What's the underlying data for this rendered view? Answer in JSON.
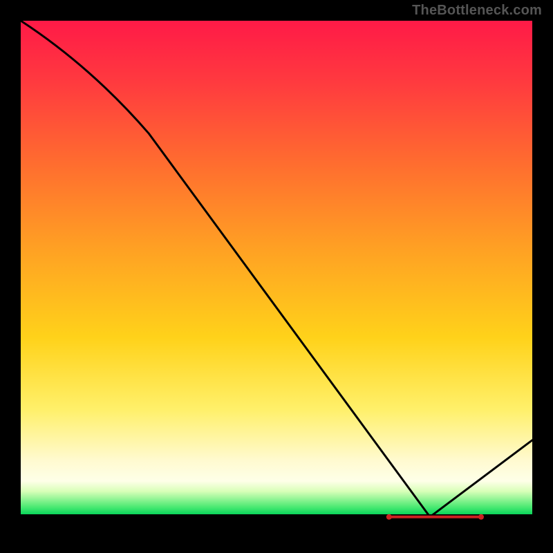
{
  "watermark": "TheBottleneck.com",
  "chart_data": {
    "type": "line",
    "title": "",
    "xlabel": "",
    "ylabel": "",
    "xlim": [
      0,
      100
    ],
    "ylim": [
      0,
      100
    ],
    "x": [
      0,
      25,
      80,
      100
    ],
    "values": [
      100,
      78,
      3,
      18
    ],
    "marker_segment": {
      "x_start": 72,
      "x_end": 90,
      "y": 3
    },
    "gradient_stops": [
      {
        "pos": 0.0,
        "color": "#ff1a47"
      },
      {
        "pos": 0.28,
        "color": "#ff6d2f"
      },
      {
        "pos": 0.62,
        "color": "#ffd21a"
      },
      {
        "pos": 0.9,
        "color": "#feffe8"
      },
      {
        "pos": 0.965,
        "color": "#09d65b"
      },
      {
        "pos": 1.0,
        "color": "#000000"
      }
    ]
  }
}
